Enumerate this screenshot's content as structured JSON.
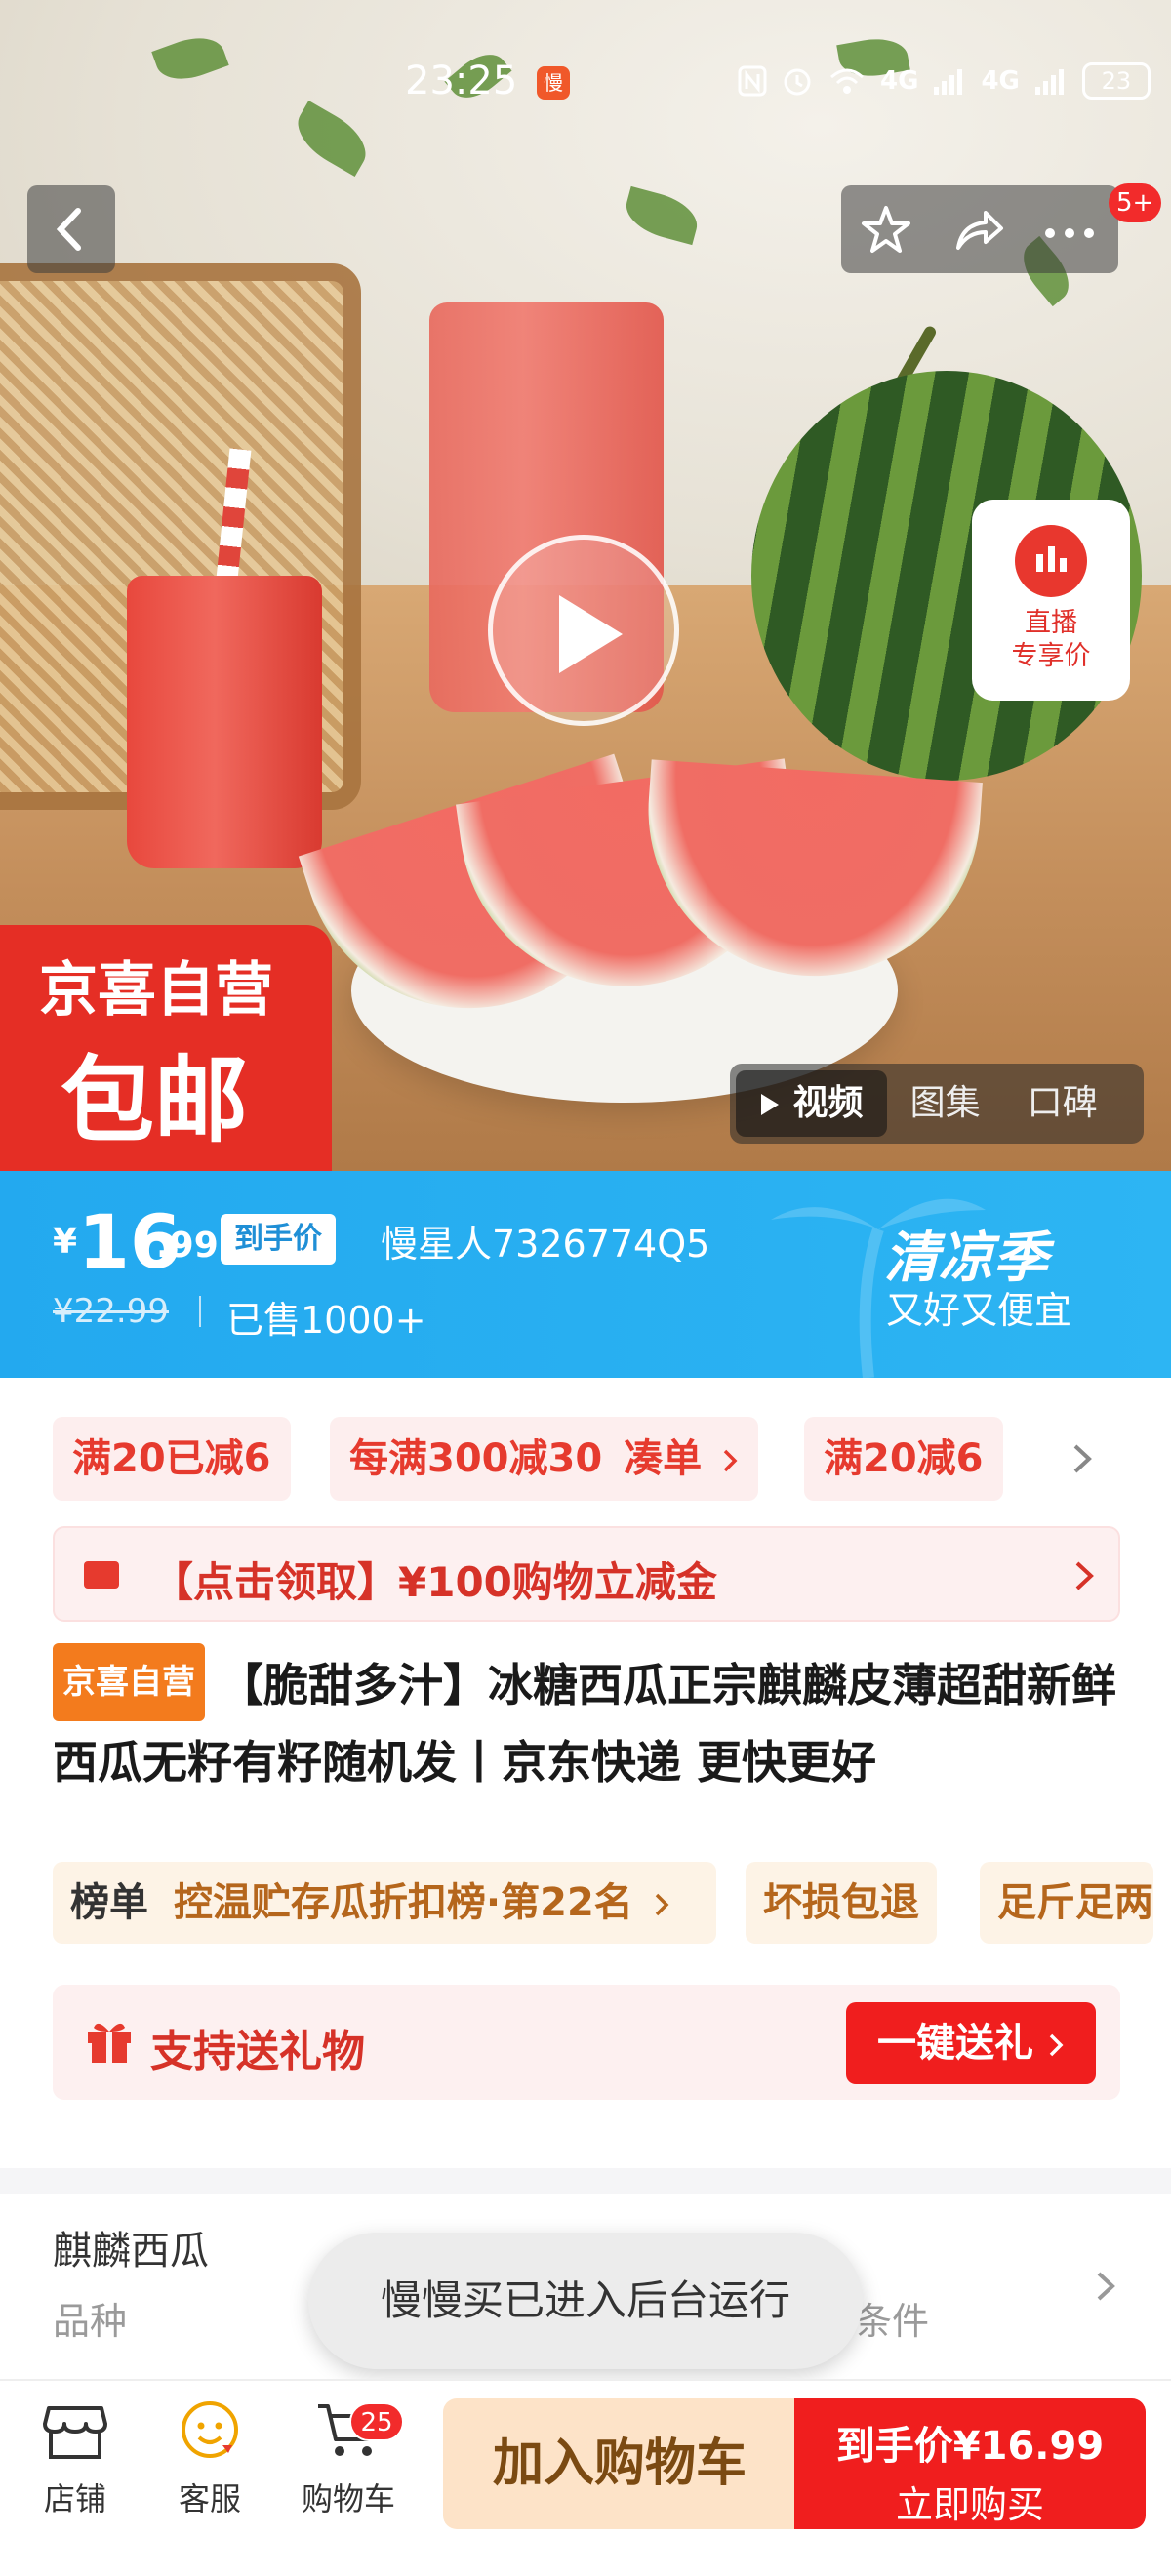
{
  "status_bar": {
    "time": "23:25",
    "app_icon": "慢",
    "network": "4G",
    "battery": "23"
  },
  "nav": {
    "badge": "5+"
  },
  "live": {
    "line1": "直播",
    "line2": "专享价"
  },
  "jx_badge": {
    "line1": "京喜自营",
    "line2": "包邮"
  },
  "media_tabs": [
    "视频",
    "图集",
    "口碑"
  ],
  "price": {
    "yen": "¥",
    "main": "16",
    "decimal": ".99",
    "tag": "到手价",
    "seller": "慢星人7326774Q5",
    "original": "¥22.99",
    "sold": "已售1000+",
    "season": "清凉季",
    "slogan": "又好又便宜"
  },
  "coupons": {
    "chips": [
      "满20已减6",
      "每满300减30",
      "凑单",
      "满20减6"
    ],
    "claim": "【点击领取】¥100购物立减金"
  },
  "title": {
    "badge": "京喜自营",
    "text": "【脆甜多汁】冰糖西瓜正宗麒麟皮薄超甜新鲜西瓜无籽有籽随机发丨京东快递 更快更好"
  },
  "rank": {
    "label": "榜单",
    "text": "控温贮存瓜折扣榜·第22名",
    "tag1": "坏损包退",
    "tag2": "足斤足两"
  },
  "gift": {
    "label": "支持送礼物",
    "button": "一键送礼"
  },
  "specs": {
    "value1": "麒麟西瓜",
    "label1": "品种",
    "label3": "条件"
  },
  "toast": "慢慢买已进入后台运行",
  "bottom": {
    "store": "店铺",
    "service": "客服",
    "cart": "购物车",
    "cart_count": "25",
    "add_cart": "加入购物车",
    "buy_line1": "到手价¥16.99",
    "buy_line2": "立即购买"
  },
  "colors": {
    "price_band": "#2db5f3",
    "red": "#f01e1e",
    "jx_orange": "#f37b1d"
  }
}
